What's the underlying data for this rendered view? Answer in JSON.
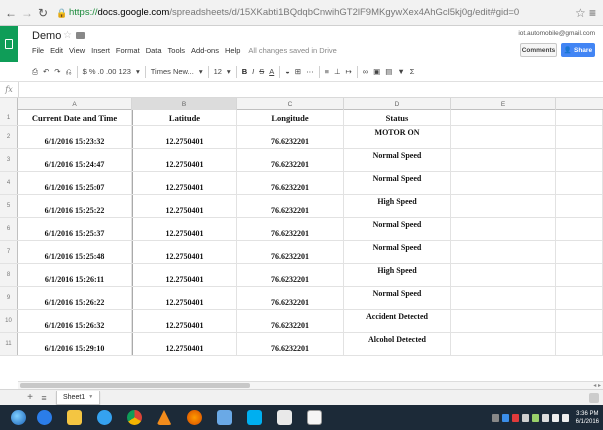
{
  "browser": {
    "url_scheme": "https://",
    "url_host": "docs.google.com",
    "url_path": "/spreadsheets/d/15XKabti1BQdqbCnwihGT2lF9MKgywXex4AhGcl5kj0g/edit#gid=0"
  },
  "doc": {
    "title": "Demo",
    "menu": [
      "File",
      "Edit",
      "View",
      "Insert",
      "Format",
      "Data",
      "Tools",
      "Add-ons",
      "Help"
    ],
    "save_status": "All changes saved in Drive",
    "account_email": "iot.automobile@gmail.com",
    "comments_label": "Comments",
    "share_label": "Share"
  },
  "toolbar": {
    "number_formats": "$ % .0 .00 123",
    "font_name": "Times New...",
    "font_size": "12",
    "bold": "B",
    "italic": "I",
    "strike": "S",
    "text_color": "A"
  },
  "formula": {
    "fx_label": "fx"
  },
  "grid": {
    "column_letters": [
      "A",
      "B",
      "C",
      "D",
      "E"
    ],
    "selected_column": "B",
    "headers": [
      "Current Date and Time",
      "Latitude",
      "Longitude",
      "Status"
    ],
    "rows": [
      {
        "num": "2",
        "time": "6/1/2016 15:23:32",
        "lat": "12.2750401",
        "lon": "76.6232201",
        "status": "MOTOR ON"
      },
      {
        "num": "3",
        "time": "6/1/2016 15:24:47",
        "lat": "12.2750401",
        "lon": "76.6232201",
        "status": "Normal Speed"
      },
      {
        "num": "4",
        "time": "6/1/2016 15:25:07",
        "lat": "12.2750401",
        "lon": "76.6232201",
        "status": "Normal Speed"
      },
      {
        "num": "5",
        "time": "6/1/2016 15:25:22",
        "lat": "12.2750401",
        "lon": "76.6232201",
        "status": "High Speed"
      },
      {
        "num": "6",
        "time": "6/1/2016 15:25:37",
        "lat": "12.2750401",
        "lon": "76.6232201",
        "status": "Normal Speed"
      },
      {
        "num": "7",
        "time": "6/1/2016 15:25:48",
        "lat": "12.2750401",
        "lon": "76.6232201",
        "status": "Normal Speed"
      },
      {
        "num": "8",
        "time": "6/1/2016 15:26:11",
        "lat": "12.2750401",
        "lon": "76.6232201",
        "status": "High Speed"
      },
      {
        "num": "9",
        "time": "6/1/2016 15:26:22",
        "lat": "12.2750401",
        "lon": "76.6232201",
        "status": "Normal Speed"
      },
      {
        "num": "10",
        "time": "6/1/2016 15:26:32",
        "lat": "12.2750401",
        "lon": "76.6232201",
        "status": "Accident Detected"
      },
      {
        "num": "11",
        "time": "6/1/2016 15:29:10",
        "lat": "12.2750401",
        "lon": "76.6232201",
        "status": "Alcohol Detected"
      }
    ]
  },
  "sheets": {
    "tabs": [
      "Sheet1"
    ]
  },
  "taskbar": {
    "apps": [
      "ie-icon",
      "explorer-icon",
      "ie-icon-2",
      "chrome-icon",
      "vlc-icon",
      "firefox-icon",
      "folder-icon",
      "skype-icon",
      "paint-icon",
      "pdf-icon"
    ],
    "clock_time": "3:36 PM",
    "clock_date": "6/1/2016"
  },
  "colors": {
    "sheets_green": "#0f9d58",
    "share_blue": "#4285f4",
    "taskbar_bg": "#1c2a38"
  }
}
